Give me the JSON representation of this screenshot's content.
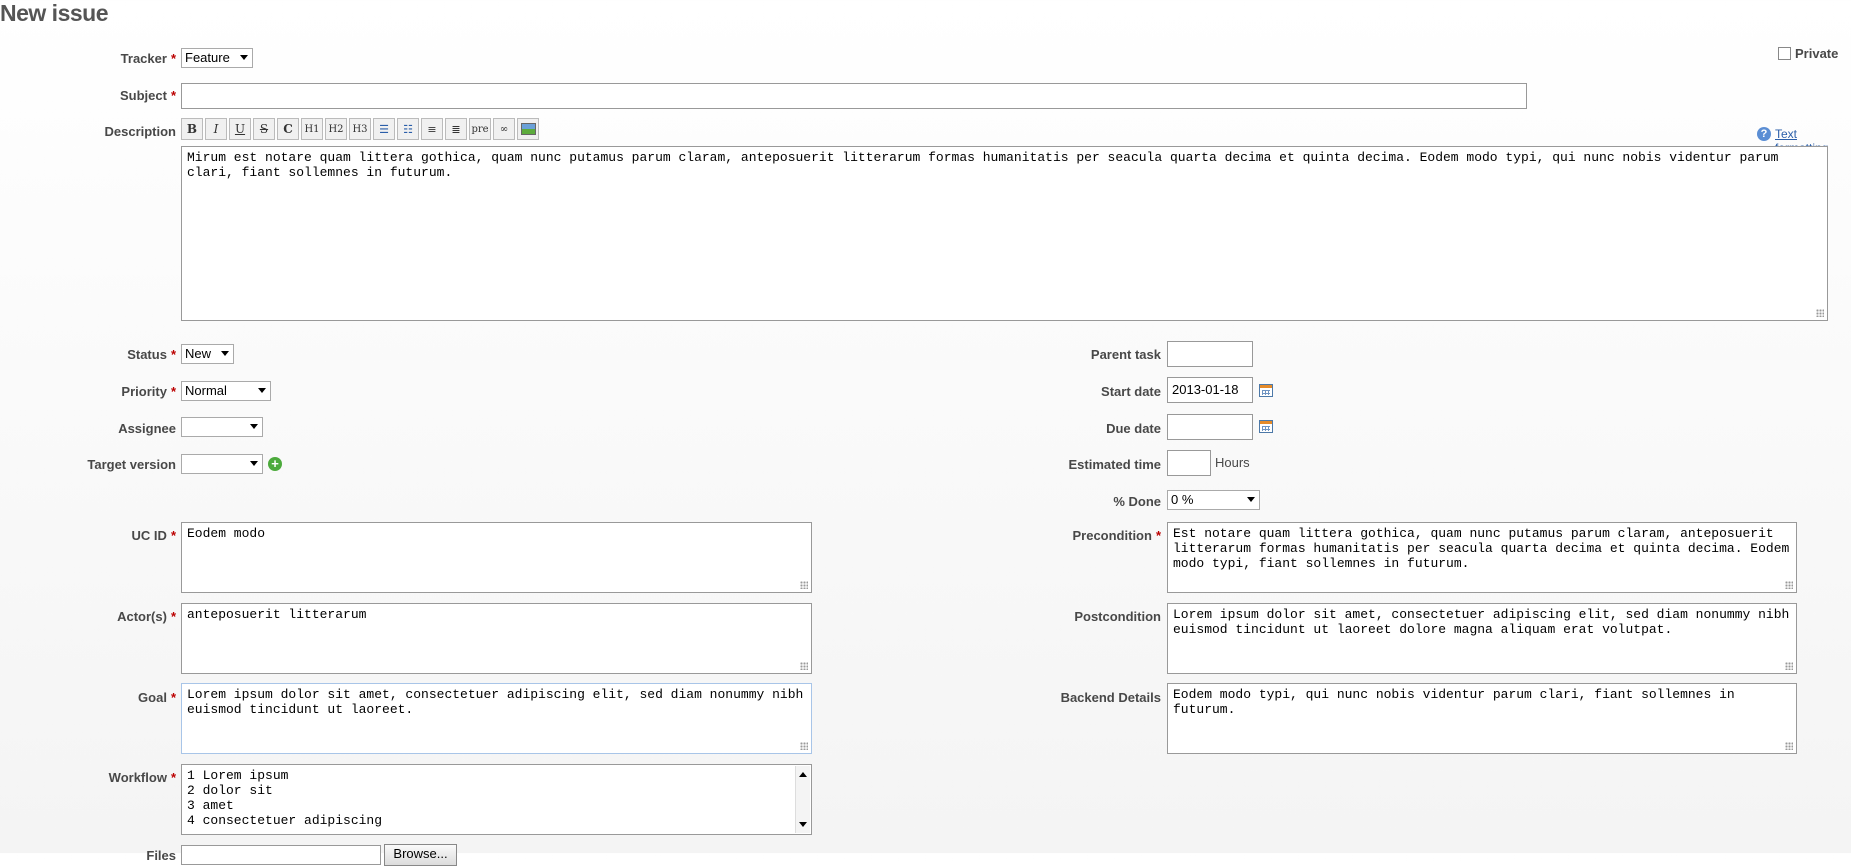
{
  "page": {
    "title": "New issue"
  },
  "toolbar_buttons": [
    "B",
    "I",
    "U",
    "S",
    "C",
    "H1",
    "H2",
    "H3",
    "ul",
    "ol",
    "in",
    "out",
    "pre",
    "link",
    "img"
  ],
  "fields": {
    "tracker": {
      "label": "Tracker",
      "value": "Feature"
    },
    "private": {
      "label": "Private"
    },
    "subject": {
      "label": "Subject",
      "value": ""
    },
    "description": {
      "label": "Description",
      "help_link": "Text formatting",
      "value": "Mirum est notare quam littera gothica, quam nunc putamus parum claram, anteposuerit litterarum formas humanitatis per seacula quarta decima et quinta decima. Eodem modo typi, qui nunc nobis videntur parum clari, fiant sollemnes in futurum."
    },
    "status": {
      "label": "Status",
      "value": "New"
    },
    "priority": {
      "label": "Priority",
      "value": "Normal"
    },
    "assignee": {
      "label": "Assignee",
      "value": ""
    },
    "target_version": {
      "label": "Target version",
      "value": ""
    },
    "parent_task": {
      "label": "Parent task",
      "value": ""
    },
    "start_date": {
      "label": "Start date",
      "value": "2013-01-18"
    },
    "due_date": {
      "label": "Due date",
      "value": ""
    },
    "estimated_time": {
      "label": "Estimated time",
      "value": "",
      "unit": "Hours"
    },
    "done": {
      "label": "% Done",
      "value": "0 %"
    },
    "uc_id": {
      "label": "UC ID",
      "value": "Eodem modo"
    },
    "actors": {
      "label": "Actor(s)",
      "value": "anteposuerit litterarum"
    },
    "goal": {
      "label": "Goal",
      "value": "Lorem ipsum dolor sit amet, consectetuer adipiscing elit, sed diam nonummy nibh euismod tincidunt ut laoreet."
    },
    "workflow": {
      "label": "Workflow",
      "value": "1 Lorem ipsum\n2 dolor sit\n3 amet\n4 consectetuer adipiscing"
    },
    "precondition": {
      "label": "Precondition",
      "value": "Est notare quam littera gothica, quam nunc putamus parum claram, anteposuerit litterarum formas humanitatis per seacula quarta decima et quinta decima. Eodem modo typi, fiant sollemnes in futurum."
    },
    "postcondition": {
      "label": "Postcondition",
      "value": "Lorem ipsum dolor sit amet, consectetuer adipiscing elit, sed diam nonummy nibh euismod tincidunt ut laoreet dolore magna aliquam erat volutpat."
    },
    "backend_details": {
      "label": "Backend Details",
      "value": "Eodem modo typi, qui nunc nobis videntur parum clari, fiant sollemnes in futurum."
    },
    "files": {
      "label": "Files",
      "browse": "Browse..."
    }
  },
  "required_marker": "*"
}
